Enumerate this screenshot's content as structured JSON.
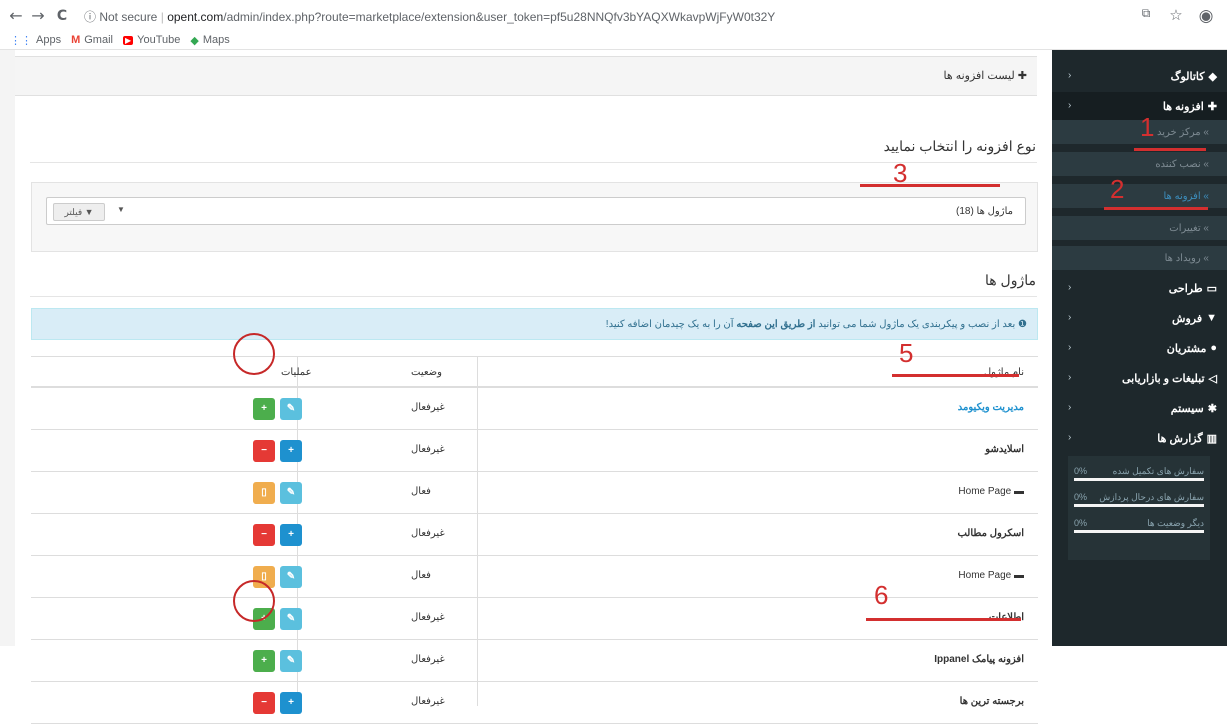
{
  "browser": {
    "back_icon": "←",
    "forward_icon": "→",
    "reload_icon": "C",
    "security_label": "ⓘ Not secure",
    "separator": "|",
    "url_host": "opent.com",
    "url_path": "/admin/index.php?route=marketplace/extension&user_token=pf5u28NNQfv3bYAQXWkavpWjFyW0t32Y",
    "bookmarks": [
      {
        "label": "Apps",
        "icon": "apps-icon",
        "color": "#4285f4"
      },
      {
        "label": "Gmail",
        "icon": "gmail-icon",
        "color": "#ea4335"
      },
      {
        "label": "YouTube",
        "icon": "youtube-icon",
        "color": "#ff0000"
      },
      {
        "label": "Maps",
        "icon": "maps-icon",
        "color": "#34a853"
      }
    ]
  },
  "sidebar": {
    "menu": [
      {
        "label": "کاتالوگ",
        "icon": "tags-icon"
      },
      {
        "label": "افزونه ها",
        "icon": "puzzle-icon"
      },
      {
        "label": "طراحی",
        "icon": "desktop-icon"
      },
      {
        "label": "فروش",
        "icon": "cart-icon"
      },
      {
        "label": "مشتریان",
        "icon": "user-icon"
      },
      {
        "label": "تبلیغات و بازاریابی",
        "icon": "share-icon"
      },
      {
        "label": "سیستم",
        "icon": "gear-icon"
      },
      {
        "label": "گزارش ها",
        "icon": "bar-chart-icon"
      }
    ],
    "submenu": [
      {
        "label": "» مرکز خرید"
      },
      {
        "label": "» نصب کننده"
      },
      {
        "label": "» افزونه ها"
      },
      {
        "label": "» تغییرات"
      },
      {
        "label": "» رویداد ها"
      }
    ],
    "stats": [
      {
        "label": "سفارش های تکمیل شده",
        "value": "0%"
      },
      {
        "label": "سفارش های درحال پردازش",
        "value": "0%"
      },
      {
        "label": "دیگر وضعیت ها",
        "value": "0%"
      }
    ]
  },
  "main": {
    "page_title": "لیست افزونه ها",
    "select_type_title": "نوع افزونه را انتخاب نمایید",
    "module_select_value": "ماژول ها (18)",
    "filter_button": "فیلتر",
    "modules_title": "ماژول ها",
    "info_text_1": "بعد از نصب و پیکربندی یک ماژول شما می توانید",
    "info_text_bold": "از طریق این صفحه",
    "info_text_2": "آن را به یک چیدمان اضافه کنید!",
    "table": {
      "headers": {
        "name": "نام ماژول",
        "status": "وضعیت",
        "actions": "عملیات"
      },
      "rows": [
        {
          "name": "مدیریت ویکیومد",
          "status": "غیرفعال",
          "kind": "link",
          "buttons": [
            "edit",
            "install"
          ]
        },
        {
          "name": "اسلایدشو",
          "status": "غیرفعال",
          "kind": "plain",
          "buttons": [
            "add",
            "uninstall"
          ]
        },
        {
          "name": "Home Page",
          "status": "فعال",
          "kind": "folder",
          "buttons": [
            "edit",
            "delete"
          ]
        },
        {
          "name": "اسکرول مطالب",
          "status": "غیرفعال",
          "kind": "plain",
          "buttons": [
            "add",
            "uninstall"
          ]
        },
        {
          "name": "Home Page",
          "status": "فعال",
          "kind": "folder",
          "buttons": [
            "edit",
            "delete"
          ]
        },
        {
          "name": "اطلاعات",
          "status": "غیرفعال",
          "kind": "plain",
          "buttons": [
            "edit",
            "install"
          ]
        },
        {
          "name": "افزونه پیامک Ippanel",
          "status": "غیرفعال",
          "kind": "plain",
          "buttons": [
            "edit",
            "install"
          ]
        },
        {
          "name": "برجسته ترین ها",
          "status": "غیرفعال",
          "kind": "plain",
          "buttons": [
            "add",
            "uninstall"
          ]
        }
      ]
    }
  },
  "annotations": [
    "1",
    "2",
    "3",
    "5",
    "6"
  ],
  "colors": {
    "sidebar_bg": "#1e282c",
    "link": "#1e91cf",
    "annotation": "#d32f2f"
  }
}
